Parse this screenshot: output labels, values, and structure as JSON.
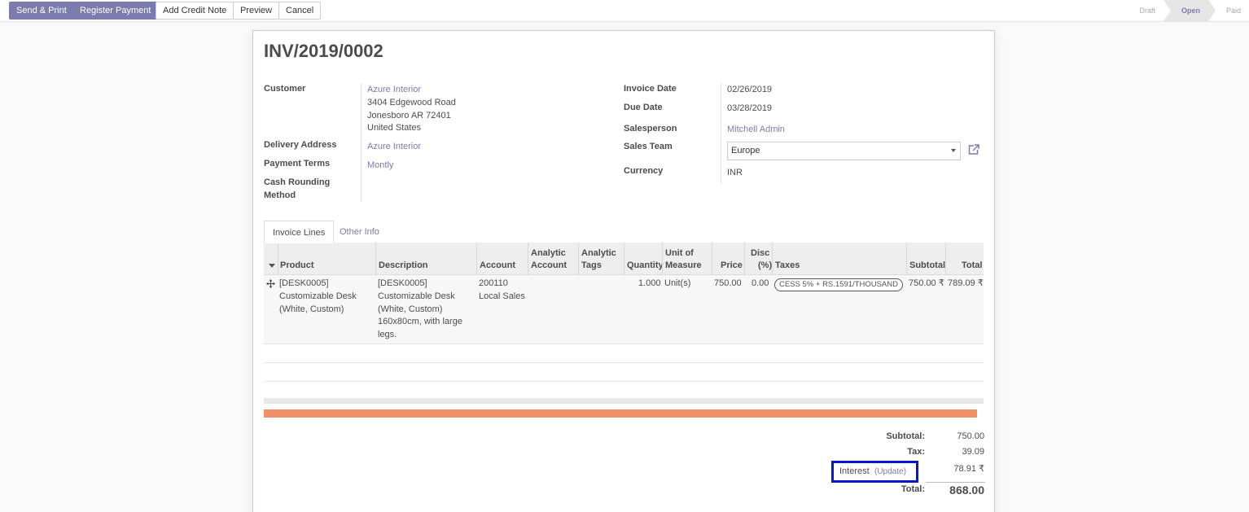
{
  "toolbar": {
    "send_print": "Send & Print",
    "register_payment": "Register Payment",
    "add_credit_note": "Add Credit Note",
    "preview": "Preview",
    "cancel": "Cancel"
  },
  "status": {
    "stages": [
      "Draft",
      "Open",
      "Paid"
    ],
    "active": "Open"
  },
  "invoice": {
    "number": "INV/2019/0002",
    "customer_label": "Customer",
    "customer_name": "Azure Interior",
    "customer_address": [
      "3404 Edgewood Road",
      "Jonesboro AR 72401",
      "United States"
    ],
    "delivery_label": "Delivery Address",
    "delivery_value": "Azure Interior",
    "payment_terms_label": "Payment Terms",
    "payment_terms_value": "Montly",
    "cash_rounding_label_1": "Cash Rounding",
    "cash_rounding_label_2": "Method",
    "invoice_date_label": "Invoice Date",
    "invoice_date_value": "02/26/2019",
    "due_date_label": "Due Date",
    "due_date_value": "03/28/2019",
    "salesperson_label": "Salesperson",
    "salesperson_value": "Mitchell Admin",
    "sales_team_label": "Sales Team",
    "sales_team_value": "Europe",
    "currency_label": "Currency",
    "currency_value": "INR"
  },
  "tabs": {
    "invoice_lines": "Invoice Lines",
    "other_info": "Other Info"
  },
  "table": {
    "headers": {
      "product": "Product",
      "description": "Description",
      "account": "Account",
      "analytic_account_1": "Analytic",
      "analytic_account_2": "Account",
      "analytic_tags_1": "Analytic",
      "analytic_tags_2": "Tags",
      "quantity": "Quantity",
      "uom_1": "Unit of",
      "uom_2": "Measure",
      "price": "Price",
      "disc_1": "Disc",
      "disc_2": "(%)",
      "taxes": "Taxes",
      "subtotal": "Subtotal",
      "total": "Total"
    },
    "rows": [
      {
        "product": [
          "[DESK0005]",
          "Customizable Desk",
          "(White, Custom)"
        ],
        "description": [
          "[DESK0005]",
          "Customizable Desk",
          "(White, Custom)",
          "160x80cm, with large",
          "legs."
        ],
        "account": [
          "200110",
          "Local Sales"
        ],
        "quantity": "1.000",
        "uom": "Unit(s)",
        "price": "750.00",
        "discount": "0.00",
        "tax": "CESS 5% + RS.1591/THOUSAND",
        "subtotal": "750.00 ₹",
        "total": "789.09 ₹"
      }
    ]
  },
  "totals": {
    "subtotal_label": "Subtotal:",
    "subtotal_value": "750.00",
    "tax_label": "Tax:",
    "tax_value": "39.09",
    "interest_label": "Interest",
    "interest_update": "(Update)",
    "interest_value": "78.91 ₹",
    "total_label": "Total:",
    "total_value": "868.00"
  },
  "colors": {
    "primary": "#7c7bad",
    "progress": "#f0916a",
    "highlight": "#0a14c8"
  },
  "icons": {
    "sort": "caret-down-icon",
    "drag": "drag-handle-icon",
    "external": "external-link-icon"
  }
}
